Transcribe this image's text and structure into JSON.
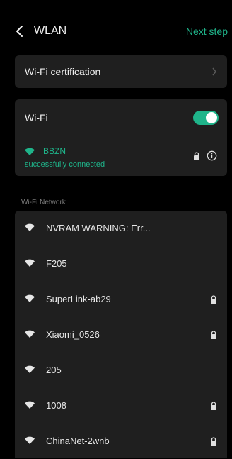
{
  "header": {
    "title": "WLAN",
    "next_label": "Next step"
  },
  "certification": {
    "label": "Wi-Fi certification"
  },
  "wifi": {
    "label": "Wi-Fi",
    "enabled": true,
    "connected": {
      "name": "BBZN",
      "status": "successfully connected"
    }
  },
  "networks_section": {
    "label": "Wi-Fi Network"
  },
  "networks": [
    {
      "name": "NVRAM WARNING: Err...",
      "locked": false
    },
    {
      "name": "F205",
      "locked": false
    },
    {
      "name": "SuperLink-ab29",
      "locked": true
    },
    {
      "name": "Xiaomi_0526",
      "locked": true
    },
    {
      "name": "205",
      "locked": false
    },
    {
      "name": "1008",
      "locked": true
    },
    {
      "name": "ChinaNet-2wnb",
      "locked": true
    }
  ],
  "colors": {
    "accent": "#1fb48a",
    "card": "#1f1f1f",
    "background": "#000000"
  }
}
